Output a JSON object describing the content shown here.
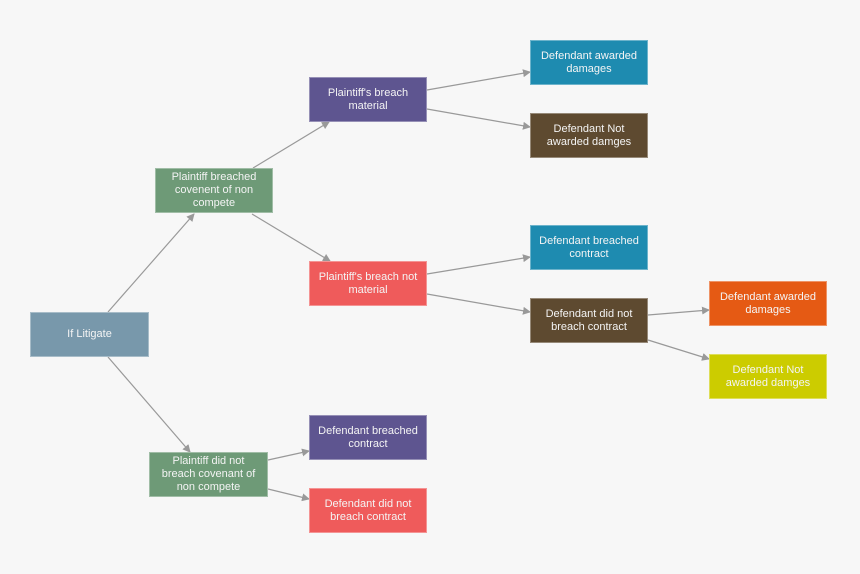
{
  "nodes": {
    "if_litigate": {
      "label": "If Litigate",
      "color": "#7898ab"
    },
    "plaintiff_breached": {
      "label": "Plaintiff breached covenent of non compete",
      "color": "#6e9a77"
    },
    "plaintiff_not_breach": {
      "label": "Plaintiff did not breach covenant of non compete",
      "color": "#6e9a77"
    },
    "breach_material": {
      "label": "Plaintiff's breach material",
      "color": "#5e5590"
    },
    "breach_not_material": {
      "label": "Plaintiff's breach not material",
      "color": "#ef5b5b"
    },
    "def_awarded_1": {
      "label": "Defendant awarded damages",
      "color": "#1e8bb0"
    },
    "def_not_awarded_1": {
      "label": "Defendant Not awarded damges",
      "color": "#5e4a30"
    },
    "def_breached_1": {
      "label": "Defendant breached contract",
      "color": "#1e8bb0"
    },
    "def_did_not_1": {
      "label": "Defendant did not breach contract",
      "color": "#5e4a30"
    },
    "def_awarded_2": {
      "label": "Defendant awarded damages",
      "color": "#e55a14"
    },
    "def_not_awarded_2": {
      "label": "Defendant Not awarded damges",
      "color": "#cccc00"
    },
    "def_breached_2": {
      "label": "Defendant breached contract",
      "color": "#5e5590"
    },
    "def_did_not_2": {
      "label": "Defendant did not breach contract",
      "color": "#ef5b5b"
    }
  },
  "edges": [
    [
      "if_litigate",
      "plaintiff_breached"
    ],
    [
      "if_litigate",
      "plaintiff_not_breach"
    ],
    [
      "plaintiff_breached",
      "breach_material"
    ],
    [
      "plaintiff_breached",
      "breach_not_material"
    ],
    [
      "breach_material",
      "def_awarded_1"
    ],
    [
      "breach_material",
      "def_not_awarded_1"
    ],
    [
      "breach_not_material",
      "def_breached_1"
    ],
    [
      "breach_not_material",
      "def_did_not_1"
    ],
    [
      "def_did_not_1",
      "def_awarded_2"
    ],
    [
      "def_did_not_1",
      "def_not_awarded_2"
    ],
    [
      "plaintiff_not_breach",
      "def_breached_2"
    ],
    [
      "plaintiff_not_breach",
      "def_did_not_2"
    ]
  ],
  "edge_color": "#999999"
}
